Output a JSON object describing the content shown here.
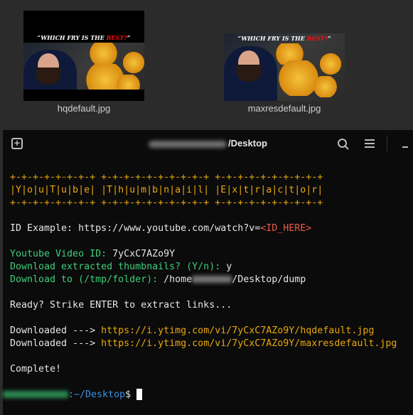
{
  "files": [
    {
      "name": "hqdefault.jpg",
      "caption_white": "“WHICH FRY IS THE ",
      "caption_red": "BEST?",
      "caption_end": "”"
    },
    {
      "name": "maxresdefault.jpg",
      "caption_white": "“WHICH FRY IS THE ",
      "caption_red": "BEST?",
      "caption_end": "”"
    }
  ],
  "terminal": {
    "title": "/Desktop",
    "icons": [
      "new-tab-icon",
      "search-icon",
      "menu-icon",
      "minimize-icon"
    ],
    "banner": [
      "+-+-+-+-+-+-+-+ +-+-+-+-+-+-+-+-+-+ +-+-+-+-+-+-+-+-+-+",
      "|Y|o|u|T|u|b|e| |T|h|u|m|b|n|a|i|l| |E|x|t|r|a|c|t|o|r|",
      "+-+-+-+-+-+-+-+ +-+-+-+-+-+-+-+-+-+ +-+-+-+-+-+-+-+-+-+"
    ],
    "id_example_label": "ID Example: https://www.youtube.com/watch?v=",
    "id_example_placeholder": "<ID_HERE>",
    "video_id_prompt": "Youtube Video ID: ",
    "video_id": "7yCxC7AZo9Y",
    "download_prompt": "Download extracted thumbnails? (Y/n): ",
    "download_answer": "y",
    "folder_prompt": "Download to (/tmp/folder): ",
    "folder_home": "/home",
    "folder_rest": "/Desktop/dump",
    "ready": "Ready? Strike ENTER to extract links...",
    "downloaded_label": "Downloaded ---> ",
    "downloads": [
      "https://i.ytimg.com/vi/7yCxC7AZo9Y/hqdefault.jpg",
      "https://i.ytimg.com/vi/7yCxC7AZo9Y/maxresdefault.jpg"
    ],
    "complete": "Complete!",
    "prompt_path": ":~/Desktop",
    "prompt_symbol": "$ "
  },
  "colors": {
    "banner": "#e8a80c",
    "prompt": "#3ccf7a",
    "placeholder": "#ef5b45",
    "path": "#3b8fe0",
    "bg": "#0b0b0b"
  }
}
